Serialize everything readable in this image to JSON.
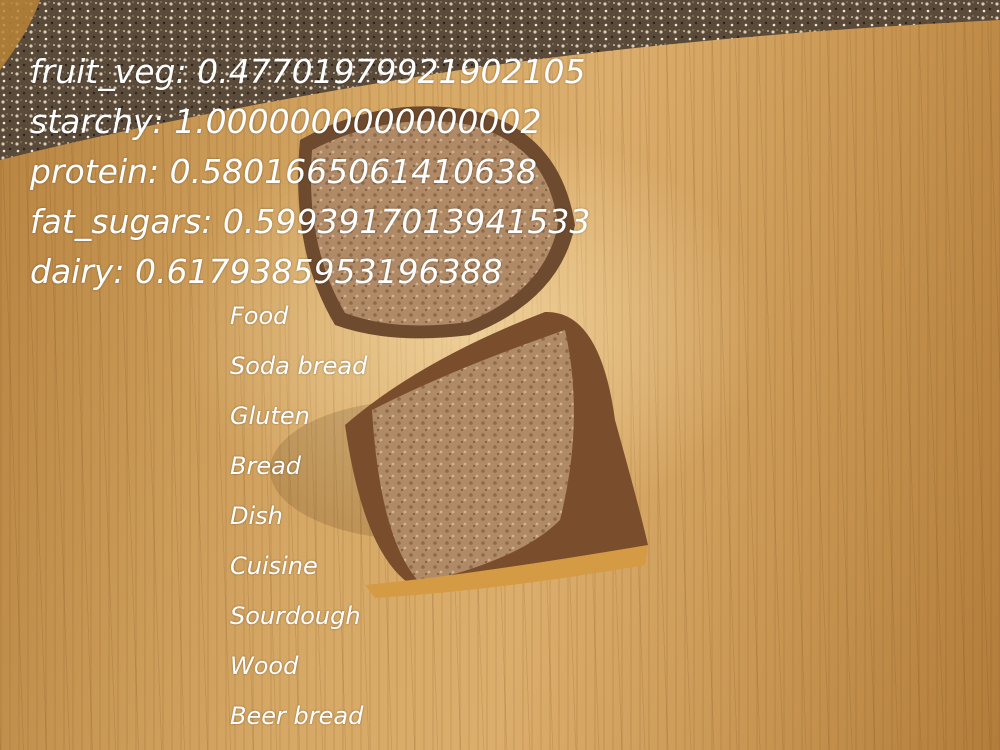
{
  "scores": [
    {
      "text": "fruit_veg: 0.47701979921902105"
    },
    {
      "text": "starchy: 1.0000000000000002"
    },
    {
      "text": "protein: 0.5801665061410638"
    },
    {
      "text": "fat_sugars: 0.5993917013941533"
    },
    {
      "text": "dairy: 0.6179385953196388"
    }
  ],
  "labels": [
    {
      "text": "Food"
    },
    {
      "text": "Soda bread"
    },
    {
      "text": "Gluten"
    },
    {
      "text": "Bread"
    },
    {
      "text": "Dish"
    },
    {
      "text": "Cuisine"
    },
    {
      "text": "Sourdough"
    },
    {
      "text": "Wood"
    },
    {
      "text": "Beer bread"
    }
  ]
}
